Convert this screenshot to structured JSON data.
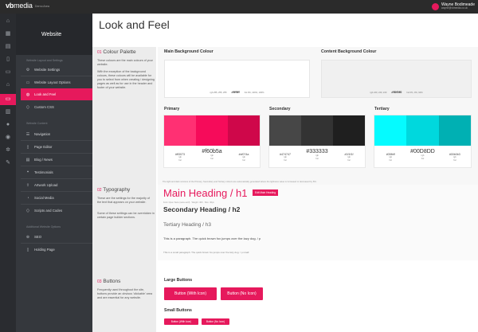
{
  "app": {
    "logo_vb": "vb",
    "logo_media": "media",
    "logo_sub": "Demo Area"
  },
  "user": {
    "name": "Wayne Bodimeade",
    "email": "wayne@vbmedia.co.uk"
  },
  "iconbar": {
    "icons": [
      "home-icon",
      "dashboard-icon",
      "grid-icon",
      "file-icon",
      "folder-icon",
      "bank-icon",
      "desktop-icon",
      "chart-icon",
      "people-icon",
      "map-pin-icon",
      "settings-icon",
      "wrench-icon"
    ],
    "active_index": 6
  },
  "sidebar": {
    "title": "Website",
    "groups": [
      "Website Layout and Settings",
      "Website Content",
      "Additional Website Options"
    ],
    "items": [
      {
        "label": "Website Settings",
        "icon": "gear-icon"
      },
      {
        "label": "Website Layout Options",
        "icon": "layout-icon"
      },
      {
        "label": "Look and Feel",
        "icon": "palette-icon"
      },
      {
        "label": "Custom CSS",
        "icon": "code-icon"
      },
      {
        "label": "Navigation",
        "icon": "navigation-icon"
      },
      {
        "label": "Page Editor",
        "icon": "page-icon"
      },
      {
        "label": "Blog / News",
        "icon": "news-icon"
      },
      {
        "label": "Testimonials",
        "icon": "quote-icon"
      },
      {
        "label": "Artwork Upload",
        "icon": "upload-icon"
      },
      {
        "label": "Social Media",
        "icon": "share-icon"
      },
      {
        "label": "Scripts and Codes",
        "icon": "script-icon"
      },
      {
        "label": "SEO",
        "icon": "seo-icon"
      },
      {
        "label": "Holding Page",
        "icon": "holding-page-icon"
      }
    ],
    "active_index": 2
  },
  "page": {
    "title": "Look and Feel"
  },
  "sections": {
    "palette": {
      "num": "01",
      "title": "Colour Palette",
      "p1": "These colours are the main colours of your website.",
      "p2": "With the exception of the background colours, these colours will be available for you to select from when creating / designing pages as well as for use in the header and footer of your website."
    },
    "typography": {
      "num": "02",
      "title": "Typography",
      "p1": "These are the settings for the majority of the text that appears on your website.",
      "p2": "Some of these settings can be overridden in certain page builder sections."
    },
    "buttons": {
      "num": "03",
      "title": "Buttons",
      "p1": "Frequently used throughout the site, buttons provide an obvious 'clickable' area and are essential for any website."
    }
  },
  "palette": {
    "main_bg": {
      "label": "Main Background Colour",
      "rgb": "rgb 255, 255, 255",
      "hex": "#ffffff",
      "hsl": "hsl 0%, 100%, 100%"
    },
    "content_bg": {
      "label": "Content Background Colour",
      "rgb": "rgb 240, 240, 240",
      "hex": "#f0f0f0",
      "hsl": "hsl 0%, 0%, 94%"
    },
    "primary": {
      "label": "Primary",
      "light": "#ff3073",
      "main": "#f60b5a",
      "dark": "#cf074a",
      "colors": [
        "#ff3073",
        "#f60b5a",
        "#cf074a"
      ]
    },
    "secondary": {
      "label": "Secondary",
      "light": "#474747",
      "main": "#333333",
      "dark": "#1f1f1f",
      "colors": [
        "#474747",
        "#333333",
        "#1f1f1f"
      ]
    },
    "tertiary": {
      "label": "Tertiary",
      "light": "#05fbff",
      "main": "#00D8DD",
      "dark": "#00b0b3",
      "colors": [
        "#05fbff",
        "#00D8DD",
        "#00b0b3"
      ]
    },
    "sub_rgb": "rgb",
    "sub_hsl": "hsl",
    "note": "The light and dark versions of the Primary, Secondary and Tertiary colours are automatically generated where the lightness value is increased or decreased by 8%."
  },
  "typography": {
    "h1": "Main Heading / h1",
    "edit_h1": "Edit Main Heading",
    "h1_meta": "Font: Open Sans (sans-serif) · Weight: 400 · Size: 40px",
    "h2": "Secondary Heading / h2",
    "h3": "Tertiary Heading / h3",
    "p": "This is a paragraph. The quick brown fox jumps over the lazy dog. / p",
    "small": "This is a small paragraph. The quick brown fox jumps over the lazy dog. / p.small"
  },
  "buttons": {
    "large_label": "Large Buttons",
    "large_with_icon": "Button (With Icon)",
    "large_no_icon": "Button (No Icon)",
    "small_label": "Small Buttons",
    "small_with_icon": "Button (With Icon)",
    "small_no_icon": "Button (No Icon)"
  }
}
